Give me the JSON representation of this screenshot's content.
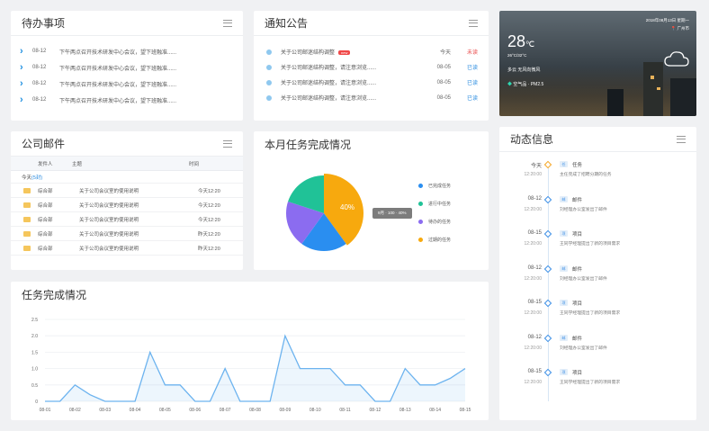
{
  "todo": {
    "title": "待办事项",
    "items": [
      {
        "date": "08-12",
        "text": "下午两点召开技术研发中心会议，望下班融准......"
      },
      {
        "date": "08-12",
        "text": "下午两点召开技术研发中心会议，望下班融准......"
      },
      {
        "date": "08-12",
        "text": "下午两点召开技术研发中心会议，望下班融准......"
      },
      {
        "date": "08-12",
        "text": "下午两点召开技术研发中心会议，望下班融准......"
      }
    ]
  },
  "notice": {
    "title": "通知公告",
    "new_tag": "new",
    "items": [
      {
        "text": "关于公司邮迷结构调整",
        "date": "今天",
        "status": "未读",
        "status_color": "#e94b4b"
      },
      {
        "text": "关于公司邮迷结构调整，请注意浏览......",
        "date": "08-05",
        "status": "已读",
        "status_color": "#2d8de0"
      },
      {
        "text": "关于公司邮迷结构调整，请注意浏览......",
        "date": "08-05",
        "status": "已读",
        "status_color": "#2d8de0"
      },
      {
        "text": "关于公司邮迷结构调整，请注意浏览......",
        "date": "08-05",
        "status": "已读",
        "status_color": "#2d8de0"
      }
    ]
  },
  "weather": {
    "datetime": "2018年08月13日 星期一",
    "location": "广州市",
    "temp": "28",
    "unit": "℃",
    "range": "26°C/32°C",
    "condition": "多云  无风向微风",
    "air": "空气品 · PM2.5",
    "icon": "cloud-icon"
  },
  "mail": {
    "title": "公司邮件",
    "columns": [
      "发件人",
      "主题",
      "时间"
    ],
    "today_label": "今天",
    "today_count": "(5封)",
    "rows": [
      {
        "sender": "综合部",
        "subject": "关于公司会议室的使用说明",
        "time": "今天12:20"
      },
      {
        "sender": "综合部",
        "subject": "关于公司会议室的使用说明",
        "time": "今天12:20"
      },
      {
        "sender": "综合部",
        "subject": "关于公司会议室的使用说明",
        "time": "今天12:20"
      },
      {
        "sender": "综合部",
        "subject": "关于公司会议室的使用说明",
        "time": "昨天12:20"
      },
      {
        "sender": "综合部",
        "subject": "关于公司会议室的使用说明",
        "time": "昨天12:20"
      }
    ]
  },
  "pie": {
    "title": "本月任务完成情况",
    "center_label": "40%",
    "tooltip": "9月 · 100 · 40%",
    "legend": [
      "已完成任务",
      "进行中任务",
      "待办的任务",
      "过期的任务"
    ],
    "colors": [
      "#2a8ef0",
      "#20c297",
      "#8b6cf0",
      "#f7a90e"
    ],
    "chart_data": {
      "type": "pie",
      "labels": [
        "已完成任务",
        "进行中任务",
        "待办的任务",
        "过期的任务"
      ],
      "values": [
        20,
        20,
        20,
        40
      ]
    }
  },
  "line": {
    "title": "任务完成情况",
    "color": "#6cb3ef",
    "chart_data": {
      "type": "area",
      "x": [
        "08-01",
        "08-01.5",
        "08-02",
        "08-02.5",
        "08-03",
        "08-03.5",
        "08-04",
        "08-04.5",
        "08-05",
        "08-05.5",
        "08-06",
        "08-06.5",
        "08-07",
        "08-07.5",
        "08-08",
        "08-08.5",
        "08-09",
        "08-09.5",
        "08-10",
        "08-10.5",
        "08-11",
        "08-11.5",
        "08-12",
        "08-12.5",
        "08-13",
        "08-13.5",
        "08-14",
        "08-14.5",
        "08-15"
      ],
      "tick_labels": [
        "08-01",
        "08-02",
        "08-03",
        "08-04",
        "08-05",
        "08-06",
        "08-07",
        "08-08",
        "08-09",
        "08-10",
        "08-11",
        "08-12",
        "08-13",
        "08-14",
        "08-15"
      ],
      "values": [
        0,
        0,
        0.5,
        0.2,
        0,
        0,
        0,
        1.5,
        0.5,
        0.5,
        0,
        0,
        1.0,
        0,
        0,
        0,
        2.0,
        1.0,
        1.0,
        1.0,
        0.5,
        0.5,
        0,
        0,
        1.0,
        0.5,
        0.5,
        0.7,
        1.0
      ],
      "yticks": [
        "2.5",
        "2.0",
        "1.5",
        "1.0",
        "0.5",
        "0"
      ],
      "ylim": [
        0,
        2.5
      ]
    }
  },
  "activity": {
    "title": "动态信息",
    "items": [
      {
        "day": "今天",
        "time": "12:20:00",
        "badge": "任",
        "type": "任务",
        "desc": "主任完成了招聘分期的任务"
      },
      {
        "day": "08-12",
        "time": "12:20:00",
        "badge": "邮",
        "type": "邮件",
        "desc": "刘经理办公室发出了邮件"
      },
      {
        "day": "08-15",
        "time": "12:20:00",
        "badge": "项",
        "type": "项目",
        "desc": "王同学经理提出了新的项目需求"
      },
      {
        "day": "08-12",
        "time": "12:20:00",
        "badge": "邮",
        "type": "邮件",
        "desc": "刘经理办公室发出了邮件"
      },
      {
        "day": "08-15",
        "time": "12:20:00",
        "badge": "项",
        "type": "项目",
        "desc": "王同学经理提出了新的项目需求"
      },
      {
        "day": "08-12",
        "time": "12:20:00",
        "badge": "邮",
        "type": "邮件",
        "desc": "刘经理办公室发出了邮件"
      },
      {
        "day": "08-15",
        "time": "12:20:00",
        "badge": "项",
        "type": "项目",
        "desc": "王同学经理提出了新的项目需求"
      }
    ]
  }
}
